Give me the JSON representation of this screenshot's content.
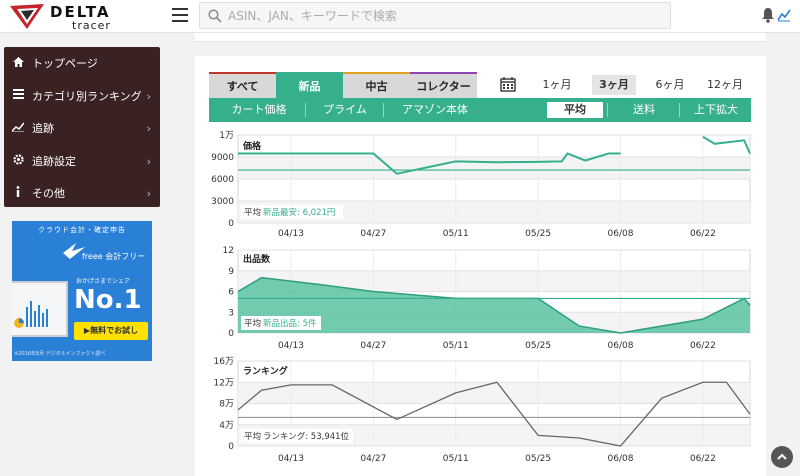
{
  "app": {
    "logo_text": "DELTA",
    "logo_sub": "tracer"
  },
  "search": {
    "placeholder": "ASIN、JAN、キーワードで検索"
  },
  "sidebar": {
    "items": [
      {
        "label": "トップページ",
        "icon": "home-icon"
      },
      {
        "label": "カテゴリ別ランキング",
        "icon": "list-icon"
      },
      {
        "label": "追跡",
        "icon": "chart-icon"
      },
      {
        "label": "追跡設定",
        "icon": "gear-icon"
      },
      {
        "label": "その他",
        "icon": "info-icon"
      }
    ]
  },
  "banner": {
    "top": "クラウド会計・確定申告",
    "brand": "freee 会計フリー",
    "mid": "おかげさまでシェア",
    "headline": "No.1",
    "button": "▶無料でお試し",
    "foot": "※2016年8月 デジタルインファクト調べ"
  },
  "condition_tabs": [
    "すべて",
    "新品",
    "中古",
    "コレクター"
  ],
  "range_tabs": [
    "1ヶ月",
    "3ヶ月",
    "6ヶ月",
    "12ヶ月"
  ],
  "active_range": "3ヶ月",
  "sub_tabs": [
    "カート価格",
    "プライム",
    "アマゾン本体",
    "平均",
    "送料",
    "上下拡大"
  ],
  "colors": {
    "accent": "#36b08c",
    "sidebar": "#3a2222",
    "line_gray": "#666666"
  },
  "charts": {
    "price": {
      "title": "価格",
      "y_ticks": [
        "1万",
        "9000",
        "6000",
        "3000",
        "0"
      ],
      "avg_label": "平均",
      "avg_text": "新品最安: 6,021円"
    },
    "sellers": {
      "title": "出品数",
      "y_ticks": [
        "12",
        "9",
        "6",
        "3",
        "0"
      ],
      "avg_label": "平均",
      "avg_text": "新品出品: 5件"
    },
    "ranking": {
      "title": "ランキング",
      "y_ticks": [
        "16万",
        "12万",
        "8万",
        "4万",
        "0"
      ],
      "avg_label": "平均",
      "avg_text": "ランキング: 53,941位"
    },
    "x_ticks": [
      "04/13",
      "04/27",
      "05/11",
      "05/25",
      "06/08",
      "06/22"
    ]
  },
  "chart_data": [
    {
      "type": "line",
      "title": "価格",
      "x": [
        "04/04",
        "04/13",
        "04/27",
        "05/01",
        "05/11",
        "05/18",
        "05/25",
        "05/29",
        "05/30",
        "06/02",
        "06/06",
        "06/08",
        "06/22",
        "06/24",
        "06/29",
        "06/30"
      ],
      "series": [
        {
          "values": [
            7900,
            7900,
            7900,
            5600,
            7000,
            6900,
            6950,
            7000,
            7900,
            7100,
            7900,
            7900,
            null,
            null,
            null,
            null
          ]
        },
        {
          "values": [
            null,
            null,
            null,
            null,
            null,
            null,
            null,
            null,
            null,
            null,
            null,
            null,
            9800,
            9000,
            9400,
            7900
          ]
        }
      ],
      "average": 6021,
      "ylim": [
        0,
        10000
      ]
    },
    {
      "type": "area",
      "title": "出品数",
      "x": [
        "04/04",
        "04/08",
        "04/18",
        "04/27",
        "05/11",
        "05/25",
        "06/01",
        "06/08",
        "06/22",
        "06/29",
        "06/30"
      ],
      "values": [
        6,
        8,
        7,
        6,
        5,
        5,
        1,
        0,
        2,
        5,
        4
      ],
      "average": 5,
      "ylim": [
        0,
        12
      ]
    },
    {
      "type": "line",
      "title": "ランキング",
      "x": [
        "04/04",
        "04/08",
        "04/13",
        "04/20",
        "05/01",
        "05/11",
        "05/18",
        "05/25",
        "06/01",
        "06/08",
        "06/15",
        "06/22",
        "06/26",
        "06/30"
      ],
      "values": [
        68000,
        105000,
        115000,
        115000,
        50000,
        100000,
        120000,
        20000,
        15000,
        0,
        90000,
        120000,
        120000,
        60000
      ],
      "average": 53941,
      "ylim": [
        0,
        160000
      ]
    }
  ]
}
